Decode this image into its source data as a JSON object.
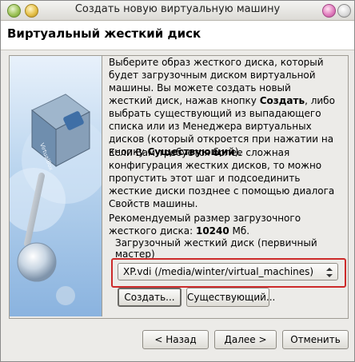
{
  "window": {
    "title": "Создать новую виртуальную машину"
  },
  "header": {
    "heading": "Виртуальный жесткий диск"
  },
  "paragraphs": {
    "p1_part1": "Выберите образ жесткого диска, который будет загрузочным диском виртуальной машины. Вы можете создать новый жесткий диск, нажав кнопку ",
    "p1_bold1": "Создать",
    "p1_part2": ", либо выбрать существующий из выпадающего списка или из Менеджера виртуальных дисков (который откроется при нажатии на кнопку ",
    "p1_bold2": "Существующий",
    "p1_part3": ").",
    "p2": "Если Вам требуется более сложная конфигурация жестких дисков, то можно пропустить этот шаг и подсоединить жесткие диски позднее с помощью диалога Свойств машины.",
    "p3_part1": "Рекомендуемый размер загрузочного жесткого диска: ",
    "p3_bold": "10240",
    "p3_part2": " Мб."
  },
  "disk_group": {
    "label": "Загрузочный жесткий диск (первичный мастер)",
    "selected": "XP.vdi (/media/winter/virtual_machines)",
    "create_button": "Создать...",
    "existing_button": "Существующий..."
  },
  "footer": {
    "back": "< Назад",
    "next": "Далее >",
    "cancel": "Отменить"
  },
  "icons": {
    "titlebar_left": [
      "green-ball-icon",
      "yellow-ball-icon"
    ],
    "titlebar_right": [
      "pink-ball-icon",
      "close-icon"
    ],
    "art": "virtualbox-cube-icon",
    "combo": "updown-arrow-icon"
  },
  "colors": {
    "highlight": "#cc2a2a",
    "art_gradient_top": "#e8f1fb",
    "art_gradient_bottom": "#8ab3df"
  }
}
